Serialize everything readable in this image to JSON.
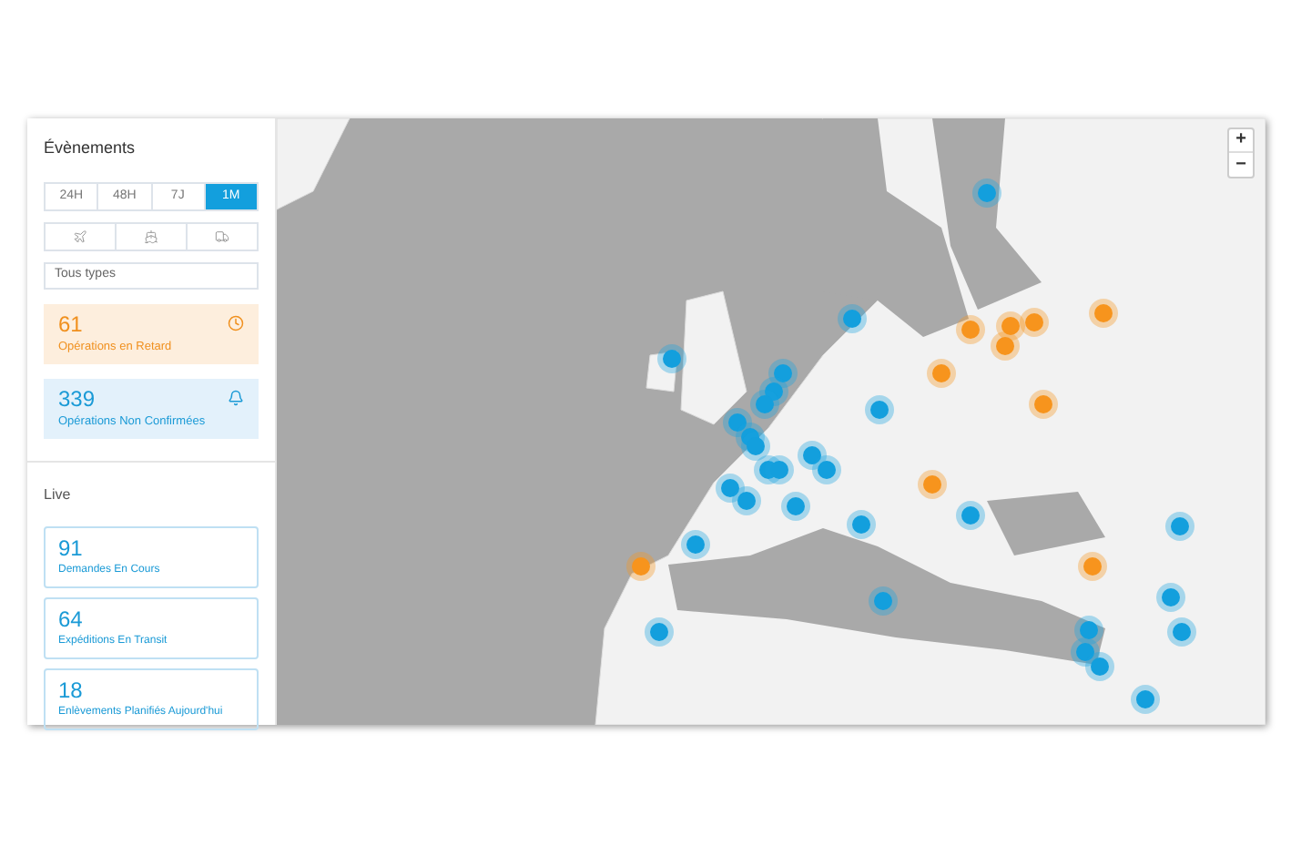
{
  "sidebar": {
    "events": {
      "title": "Évènements",
      "periods": [
        {
          "label": "24H",
          "selected": false
        },
        {
          "label": "48H",
          "selected": false
        },
        {
          "label": "7J",
          "selected": false
        },
        {
          "label": "1M",
          "selected": true
        }
      ],
      "transport_modes": [
        {
          "kind": "plane"
        },
        {
          "kind": "ship"
        },
        {
          "kind": "truck"
        }
      ],
      "type_filter": {
        "value": "Tous types"
      },
      "alerts": [
        {
          "count": "61",
          "label": "Opérations en Retard",
          "kind": "delay"
        },
        {
          "count": "339",
          "label": "Opérations Non Confirmées",
          "kind": "unconfirmed"
        }
      ]
    },
    "live": {
      "title": "Live",
      "cards": [
        {
          "count": "91",
          "label": "Demandes En Cours"
        },
        {
          "count": "64",
          "label": "Expéditions En Transit"
        },
        {
          "count": "18",
          "label": "Enlèvements Planifiés Aujourd'hui"
        }
      ]
    }
  },
  "map": {
    "zoom_controls": [
      "+",
      "−"
    ]
  }
}
